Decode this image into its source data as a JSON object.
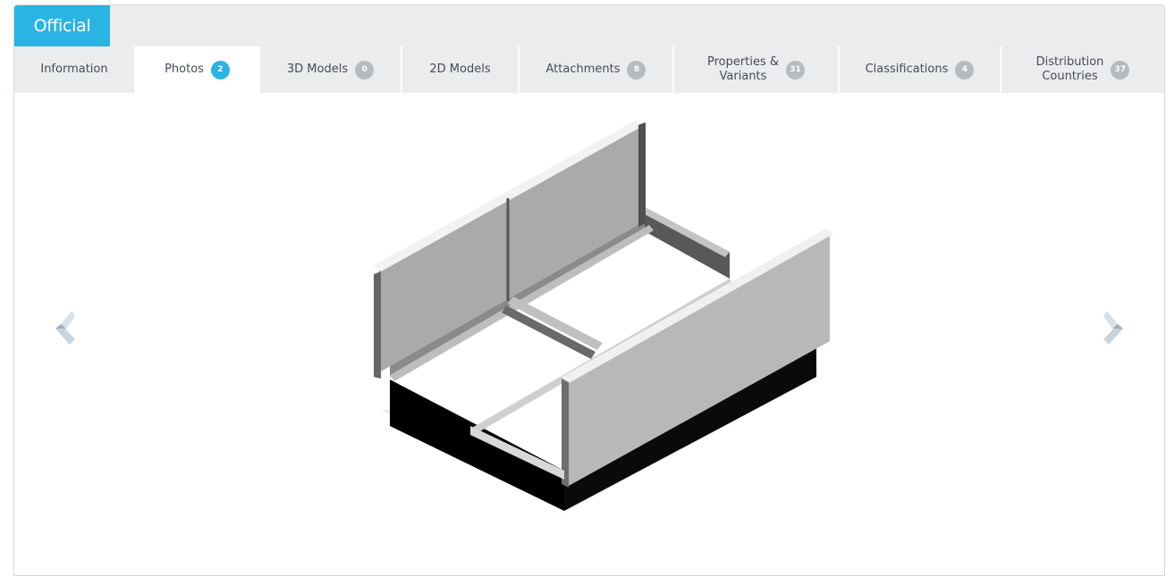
{
  "header": {
    "official_label": "Official"
  },
  "tabs": [
    {
      "label": "Information",
      "badge": null,
      "active": false
    },
    {
      "label": "Photos",
      "badge": "2",
      "active": true
    },
    {
      "label": "3D Models",
      "badge": "0",
      "active": false
    },
    {
      "label": "2D Models",
      "badge": null,
      "active": false
    },
    {
      "label": "Attachments",
      "badge": "8",
      "active": false
    },
    {
      "label": "Properties &\nVariants",
      "label_line1": "Properties &",
      "label_line2": "Variants",
      "badge": "31",
      "active": false
    },
    {
      "label": "Classifications",
      "badge": "4",
      "active": false
    },
    {
      "label": "Distribution\nCountries",
      "label_line1": "Distribution",
      "label_line2": "Countries",
      "badge": "37",
      "active": false
    }
  ],
  "gallery": {
    "prev_icon": "chevron-left-icon",
    "next_icon": "chevron-right-icon",
    "image": "3d-rendered-trough-structure-photo"
  },
  "colors": {
    "accent": "#29b4e3",
    "tab_bg": "#ebecee",
    "badge_grey": "#b5bbc0",
    "arrow": "#b9c7d2"
  }
}
